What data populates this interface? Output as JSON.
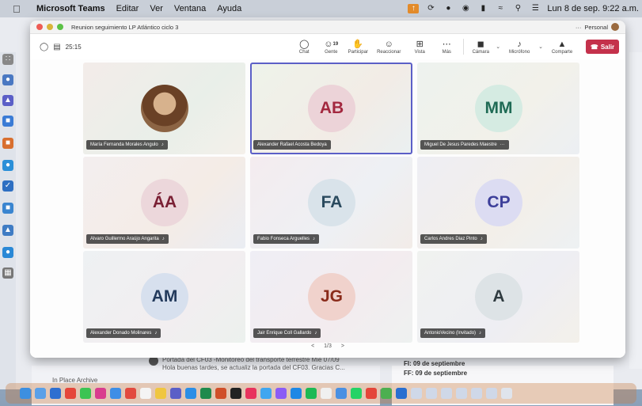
{
  "menubar": {
    "apple_icon": "apple-icon",
    "app_name": "Microsoft Teams",
    "menus": [
      "Editar",
      "Ver",
      "Ventana",
      "Ayuda"
    ],
    "clock": "Lun 8 de sep.  9:22 a.m."
  },
  "window": {
    "title": "Reunion seguimiento LP Atlántico ciclo 3",
    "more": "···",
    "profile": "Personal"
  },
  "toolbar": {
    "timer": "25:15",
    "chat": "Chat",
    "people": "Gente",
    "people_count": "19",
    "raise": "Participar",
    "react": "Reaccionar",
    "view": "Vista",
    "more": "Más",
    "camera": "Cámara",
    "mic": "Micrófono",
    "share": "Comparte",
    "leave": "Salir"
  },
  "participants": [
    {
      "name": "María Fernanda Morales Angulo",
      "initials": "",
      "photo": true,
      "avatar_bg": "#cfa07a",
      "avatar_fg": "#5a3a20",
      "muted": true
    },
    {
      "name": "Alexander Rafael Acosta Bedoya",
      "initials": "AB",
      "photo": false,
      "avatar_bg": "#ecd3d8",
      "avatar_fg": "#a3283f",
      "muted": false,
      "active": true
    },
    {
      "name": "Miguel De Jesus Paredes Maestre",
      "initials": "MM",
      "photo": false,
      "avatar_bg": "#d5ebe2",
      "avatar_fg": "#1f6b55",
      "muted": false,
      "more": "···"
    },
    {
      "name": "Alvaro Guillermo Araújo Angarita",
      "initials": "ÁA",
      "photo": false,
      "avatar_bg": "#ecd7db",
      "avatar_fg": "#7a2034",
      "muted": true
    },
    {
      "name": "Fabio Fonseca Arguelles",
      "initials": "FA",
      "photo": false,
      "avatar_bg": "#d9e3ea",
      "avatar_fg": "#2a4a5e",
      "muted": true
    },
    {
      "name": "Carlos Andres Diaz Pinto",
      "initials": "CP",
      "photo": false,
      "avatar_bg": "#dcdcf2",
      "avatar_fg": "#3d3f9a",
      "muted": true
    },
    {
      "name": "Alexander Donado Molinares",
      "initials": "AM",
      "photo": false,
      "avatar_bg": "#d7e0ee",
      "avatar_fg": "#233a5c",
      "muted": true
    },
    {
      "name": "Jair Enrique Coll Gallardo",
      "initials": "JG",
      "photo": false,
      "avatar_bg": "#f0d2cc",
      "avatar_fg": "#8a2b1a",
      "muted": true
    },
    {
      "name": "AntonioVecino (Invitado)",
      "initials": "A",
      "photo": false,
      "avatar_bg": "#dde3e6",
      "avatar_fg": "#2f3b40",
      "muted": true
    }
  ],
  "pager": {
    "prev": "<",
    "label": "1/3",
    "next": ">"
  },
  "background": {
    "chat_line1": "Portada del CF03 -Monitoreo del transporte terrestre   Mié 07/09",
    "chat_line2": "Hola buenas tardes, se actualiz la portada del CF03. Gracias C...",
    "left_bottom": "In Place Archive",
    "date1": "FI: 09 de septiembre",
    "date2": "FF: 09 de septiembre"
  },
  "colors": {
    "accent": "#5b5fc7",
    "leave": "#c4314b"
  }
}
